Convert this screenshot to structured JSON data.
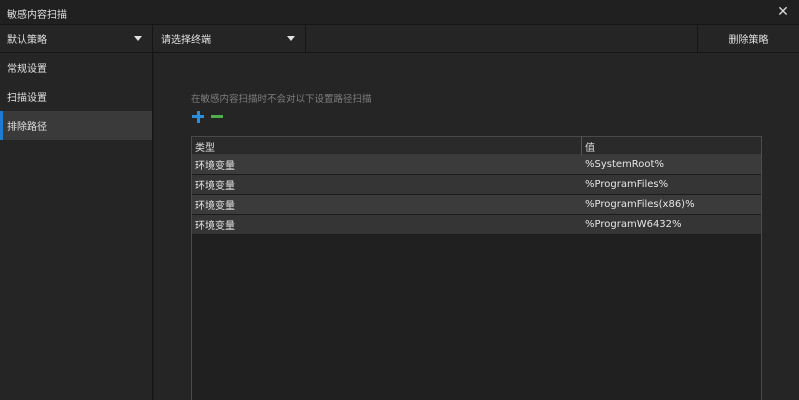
{
  "window": {
    "title": "敏感内容扫描"
  },
  "toolbar": {
    "policy_dropdown": "默认策略",
    "terminal_dropdown": "请选择终端",
    "delete_policy": "删除策略"
  },
  "sidebar": {
    "items": [
      {
        "label": "常规设置"
      },
      {
        "label": "扫描设置"
      },
      {
        "label": "排除路径"
      }
    ],
    "active_index": 2
  },
  "main": {
    "hint": "在敏感内容扫描时不会对以下设置路径扫描",
    "table": {
      "columns": [
        "类型",
        "值"
      ],
      "rows": [
        {
          "type": "环境变量",
          "value": "%SystemRoot%"
        },
        {
          "type": "环境变量",
          "value": "%ProgramFiles%"
        },
        {
          "type": "环境变量",
          "value": "%ProgramFiles(x86)%"
        },
        {
          "type": "环境变量",
          "value": "%ProgramW6432%"
        }
      ]
    }
  },
  "colors": {
    "accent": "#1e7bd0",
    "add": "#2b8fe0",
    "remove": "#4fae4a"
  },
  "icons": {
    "close": "close-icon",
    "add": "plus-icon",
    "remove": "minus-icon",
    "dropdown": "chevron-down-icon"
  }
}
